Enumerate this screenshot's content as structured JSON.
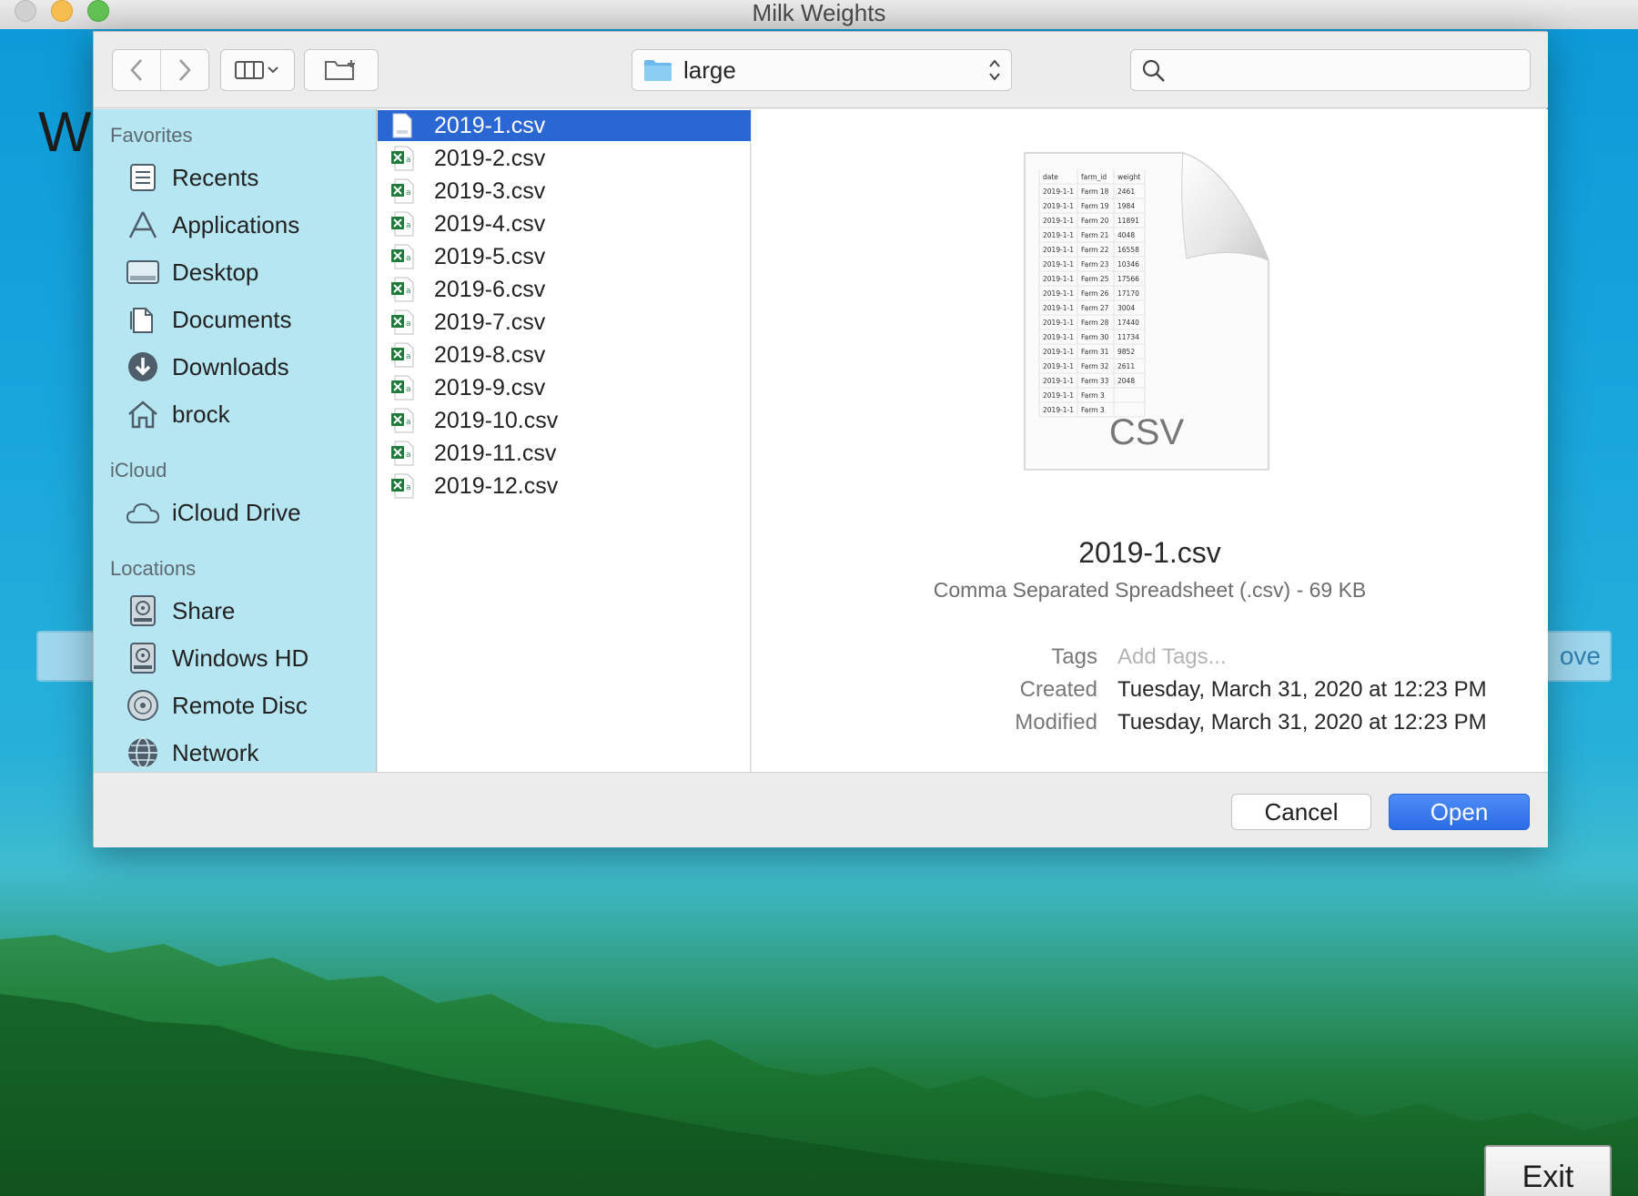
{
  "window": {
    "title": "Milk Weights"
  },
  "background_app": {
    "heading": "W",
    "right_button_label": "ove",
    "exit_label": "Exit"
  },
  "dialog": {
    "location": "large",
    "search": {
      "placeholder": "",
      "value": ""
    },
    "sidebar": {
      "sections": [
        {
          "title": "Favorites",
          "items": [
            {
              "label": "Recents",
              "icon": "recents-icon"
            },
            {
              "label": "Applications",
              "icon": "applications-icon"
            },
            {
              "label": "Desktop",
              "icon": "desktop-icon"
            },
            {
              "label": "Documents",
              "icon": "documents-icon"
            },
            {
              "label": "Downloads",
              "icon": "downloads-icon"
            },
            {
              "label": "brock",
              "icon": "home-icon"
            }
          ]
        },
        {
          "title": "iCloud",
          "items": [
            {
              "label": "iCloud Drive",
              "icon": "cloud-icon"
            }
          ]
        },
        {
          "title": "Locations",
          "items": [
            {
              "label": "Share",
              "icon": "disk-icon"
            },
            {
              "label": "Windows HD",
              "icon": "disk-icon"
            },
            {
              "label": "Remote Disc",
              "icon": "disc-icon"
            },
            {
              "label": "Network",
              "icon": "network-icon"
            }
          ]
        }
      ]
    },
    "files": [
      {
        "name": "2019-1.csv",
        "selected": true
      },
      {
        "name": "2019-2.csv"
      },
      {
        "name": "2019-3.csv"
      },
      {
        "name": "2019-4.csv"
      },
      {
        "name": "2019-5.csv"
      },
      {
        "name": "2019-6.csv"
      },
      {
        "name": "2019-7.csv"
      },
      {
        "name": "2019-8.csv"
      },
      {
        "name": "2019-9.csv"
      },
      {
        "name": "2019-10.csv"
      },
      {
        "name": "2019-11.csv"
      },
      {
        "name": "2019-12.csv"
      }
    ],
    "preview": {
      "thumbnail_headers": [
        "date",
        "farm_id",
        "weight"
      ],
      "thumbnail_rows": [
        [
          "2019-1-1",
          "Farm 18",
          "2461"
        ],
        [
          "2019-1-1",
          "Farm 19",
          "1984"
        ],
        [
          "2019-1-1",
          "Farm 20",
          "11891"
        ],
        [
          "2019-1-1",
          "Farm 21",
          "4048"
        ],
        [
          "2019-1-1",
          "Farm 22",
          "16558"
        ],
        [
          "2019-1-1",
          "Farm 23",
          "10346"
        ],
        [
          "2019-1-1",
          "Farm 25",
          "17566"
        ],
        [
          "2019-1-1",
          "Farm 26",
          "17170"
        ],
        [
          "2019-1-1",
          "Farm 27",
          "3004"
        ],
        [
          "2019-1-1",
          "Farm 28",
          "17440"
        ],
        [
          "2019-1-1",
          "Farm 30",
          "11734"
        ],
        [
          "2019-1-1",
          "Farm 31",
          "9852"
        ],
        [
          "2019-1-1",
          "Farm 32",
          "2611"
        ],
        [
          "2019-1-1",
          "Farm 33",
          "2048"
        ],
        [
          "2019-1-1",
          "Farm 3",
          ""
        ],
        [
          "2019-1-1",
          "Farm 3",
          ""
        ]
      ],
      "thumbnail_badge": "CSV",
      "filename": "2019-1.csv",
      "kind": "Comma Separated Spreadsheet (.csv) - 69 KB",
      "tags_label": "Tags",
      "tags_placeholder": "Add Tags...",
      "created_label": "Created",
      "created_value": "Tuesday, March 31, 2020 at 12:23 PM",
      "modified_label": "Modified",
      "modified_value": "Tuesday, March 31, 2020 at 12:23 PM"
    },
    "buttons": {
      "cancel": "Cancel",
      "open": "Open"
    }
  },
  "colors": {
    "accent": "#2a67d2",
    "sidebar_bg": "#b6e6f2",
    "open_button": "#2b6be6",
    "excel_green": "#1f7a3c"
  }
}
